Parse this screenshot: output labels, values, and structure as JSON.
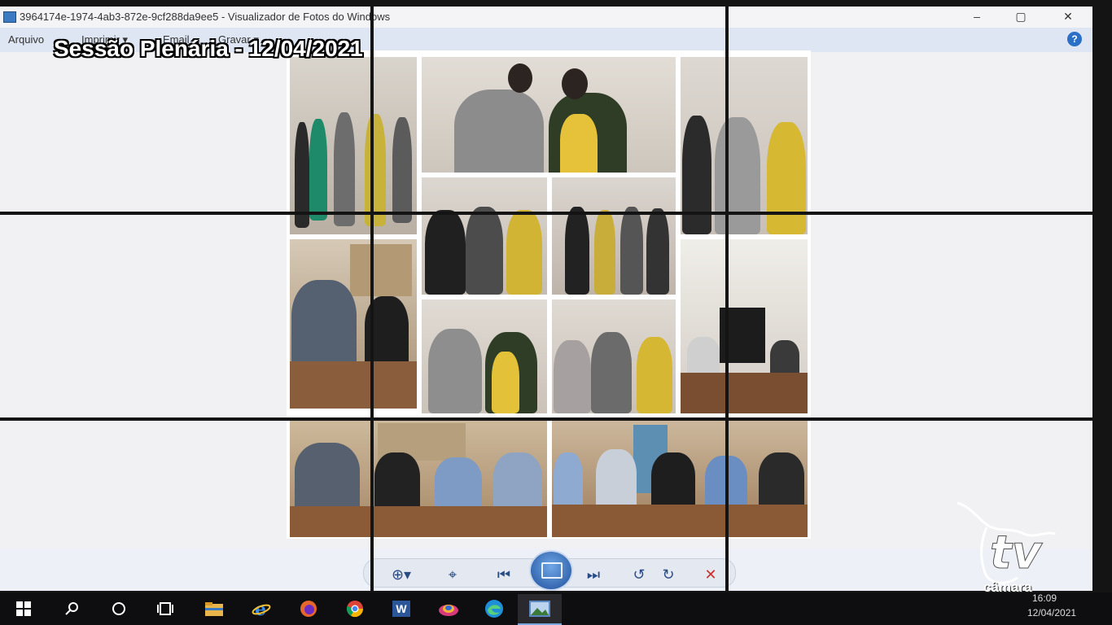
{
  "window": {
    "title": "3964174e-1974-4ab3-872e-9cf288da9ee5 - Visualizador de Fotos do Windows",
    "minimize_glyph": "–",
    "maximize_glyph": "▢",
    "close_glyph": "✕"
  },
  "menu": {
    "items": [
      "Arquivo",
      "Imprimir ▾",
      "Email",
      "Gravar ▾"
    ],
    "help_glyph": "?"
  },
  "overlay": {
    "title": "Sessão Plenária - 12/04/2021"
  },
  "toolbar": {
    "zoom_glyph": "⊕▾",
    "fit_glyph": "⌖",
    "prev_glyph": "⏮",
    "next_glyph": "⏭",
    "rotate_left_glyph": "↺",
    "rotate_right_glyph": "↻",
    "delete_glyph": "✕"
  },
  "taskbar": {
    "icons": [
      "windows-start-icon",
      "search-icon",
      "cortana-icon",
      "task-view-icon",
      "file-explorer-icon",
      "internet-explorer-icon",
      "firefox-icon",
      "chrome-icon",
      "word-icon",
      "app-icon",
      "edge-icon",
      "photos-viewer-icon"
    ],
    "word_glyph": "W",
    "time": "16:09",
    "date": "12/04/2021"
  },
  "watermark": {
    "brand": "câmara",
    "letters": "tv"
  },
  "colors": {
    "titlebar_bg": "#f4f4f6",
    "menubar_bg": "#dde6f2",
    "accent_blue": "#2b6fc6",
    "taskbar_bg": "#0e0e10",
    "delete_red": "#c9312b"
  }
}
